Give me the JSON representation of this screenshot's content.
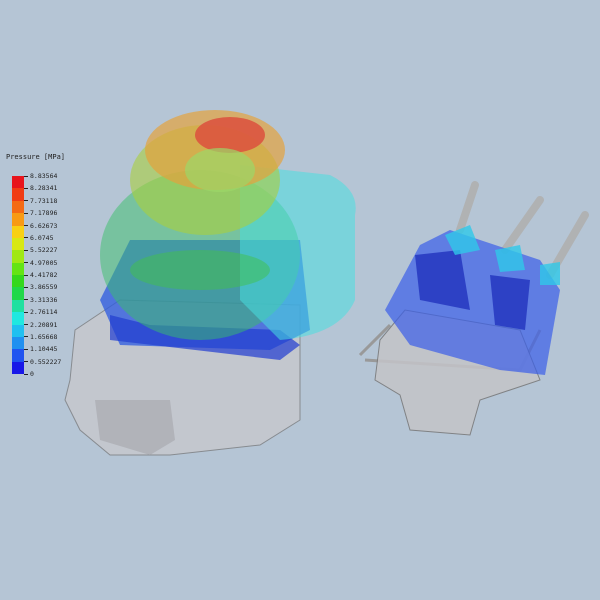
{
  "legend": {
    "title": "Pressure [MPa]",
    "labels": [
      "8.83564",
      "8.28341",
      "7.73118",
      "7.17896",
      "6.62673",
      "6.0745",
      "5.52227",
      "4.97005",
      "4.41782",
      "3.86559",
      "3.31336",
      "2.76114",
      "2.20891",
      "1.65668",
      "1.10445",
      "0.552227",
      "0"
    ],
    "colors": [
      "#e8141c",
      "#f03c14",
      "#f46a14",
      "#f89a14",
      "#f8d014",
      "#d8e814",
      "#a0e814",
      "#64e414",
      "#34d81c",
      "#20d848",
      "#20e0a0",
      "#20e8e0",
      "#20c0f0",
      "#2090f0",
      "#2054f0",
      "#1818e8"
    ]
  }
}
